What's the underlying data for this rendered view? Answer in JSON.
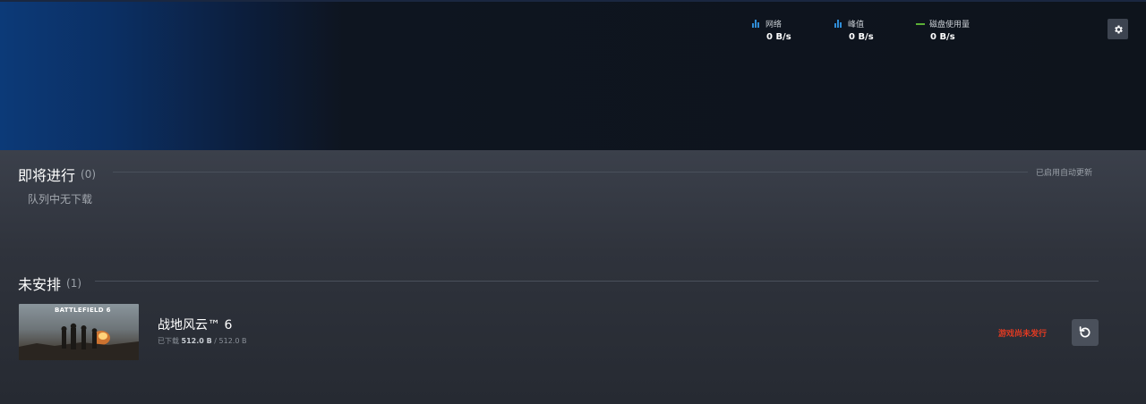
{
  "stats": {
    "network": {
      "label": "网络",
      "value": "0 B/s"
    },
    "peak": {
      "label": "峰值",
      "value": "0 B/s"
    },
    "disk": {
      "label": "磁盘使用量",
      "value": "0 B/s"
    }
  },
  "icons": {
    "settings": "gear-icon",
    "retry": "refresh-icon"
  },
  "upcoming": {
    "title": "即将进行",
    "count": "(0)",
    "auto_update_note": "已启用自动更新",
    "empty_message": "队列中无下载"
  },
  "unscheduled": {
    "title": "未安排",
    "count": "(1)",
    "items": [
      {
        "thumb_text": "BATTLEFIELD 6",
        "name": "战地风云™ 6",
        "downloaded_label": "已下载",
        "downloaded": "512.0 B",
        "separator": "/",
        "total": "512.0 B",
        "status": "游戏尚未发行"
      }
    ]
  },
  "colors": {
    "accent_blue": "#2f8cd6",
    "disk_green": "#5bb036",
    "warning_red": "#e03a22"
  }
}
